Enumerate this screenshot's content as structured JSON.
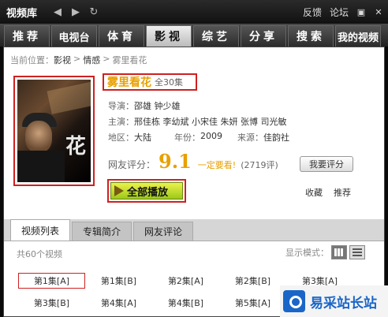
{
  "app": {
    "title": "视频库",
    "feedback": "反馈",
    "forum": "论坛"
  },
  "tabs": [
    {
      "label": "推荐"
    },
    {
      "label": "电视台"
    },
    {
      "label": "体育"
    },
    {
      "label": "影视",
      "active": true
    },
    {
      "label": "综艺"
    },
    {
      "label": "分享"
    },
    {
      "label": "搜索"
    },
    {
      "label": "我的视频"
    }
  ],
  "breadcrumb": {
    "prefix": "当前位置：",
    "items": [
      "影视",
      "情感",
      "雾里看花"
    ],
    "separator": ">"
  },
  "show": {
    "title": "雾里看花",
    "episodes": "全30集",
    "director_label": "导演：",
    "director": "邵雄  钟少雄",
    "cast_label": "主演：",
    "cast": "邢佳栋  李幼斌  小宋佳  朱妍  张博  司光敏",
    "region_label": "地区：",
    "region": "大陆",
    "year_label": "年份：",
    "year": "2009",
    "source_label": "来源：",
    "source": "佳韵社",
    "poster_glyph": "花"
  },
  "rating": {
    "label": "网友评分：",
    "score": "9.1",
    "verdict": "一定要看!",
    "count": "(2719评)",
    "rate_button": "我要评分"
  },
  "actions": {
    "play_all": "全部播放",
    "favorite": "收藏",
    "recommend": "推荐"
  },
  "subtabs": [
    {
      "label": "视频列表",
      "active": true
    },
    {
      "label": "专辑简介"
    },
    {
      "label": "网友评论"
    }
  ],
  "list": {
    "count": "共60个视频",
    "display_mode_label": "显示模式：",
    "episodes": [
      "第1集[A]",
      "第1集[B]",
      "第2集[A]",
      "第2集[B]",
      "第3集[A]",
      "第3集[B]",
      "第4集[A]",
      "第4集[B]",
      "第5集[A]"
    ]
  },
  "watermark": {
    "text": "易采站长站"
  },
  "colors": {
    "accent_orange": "#e8a000",
    "highlight_red": "#d02020",
    "play_green": "#9cc81a"
  }
}
